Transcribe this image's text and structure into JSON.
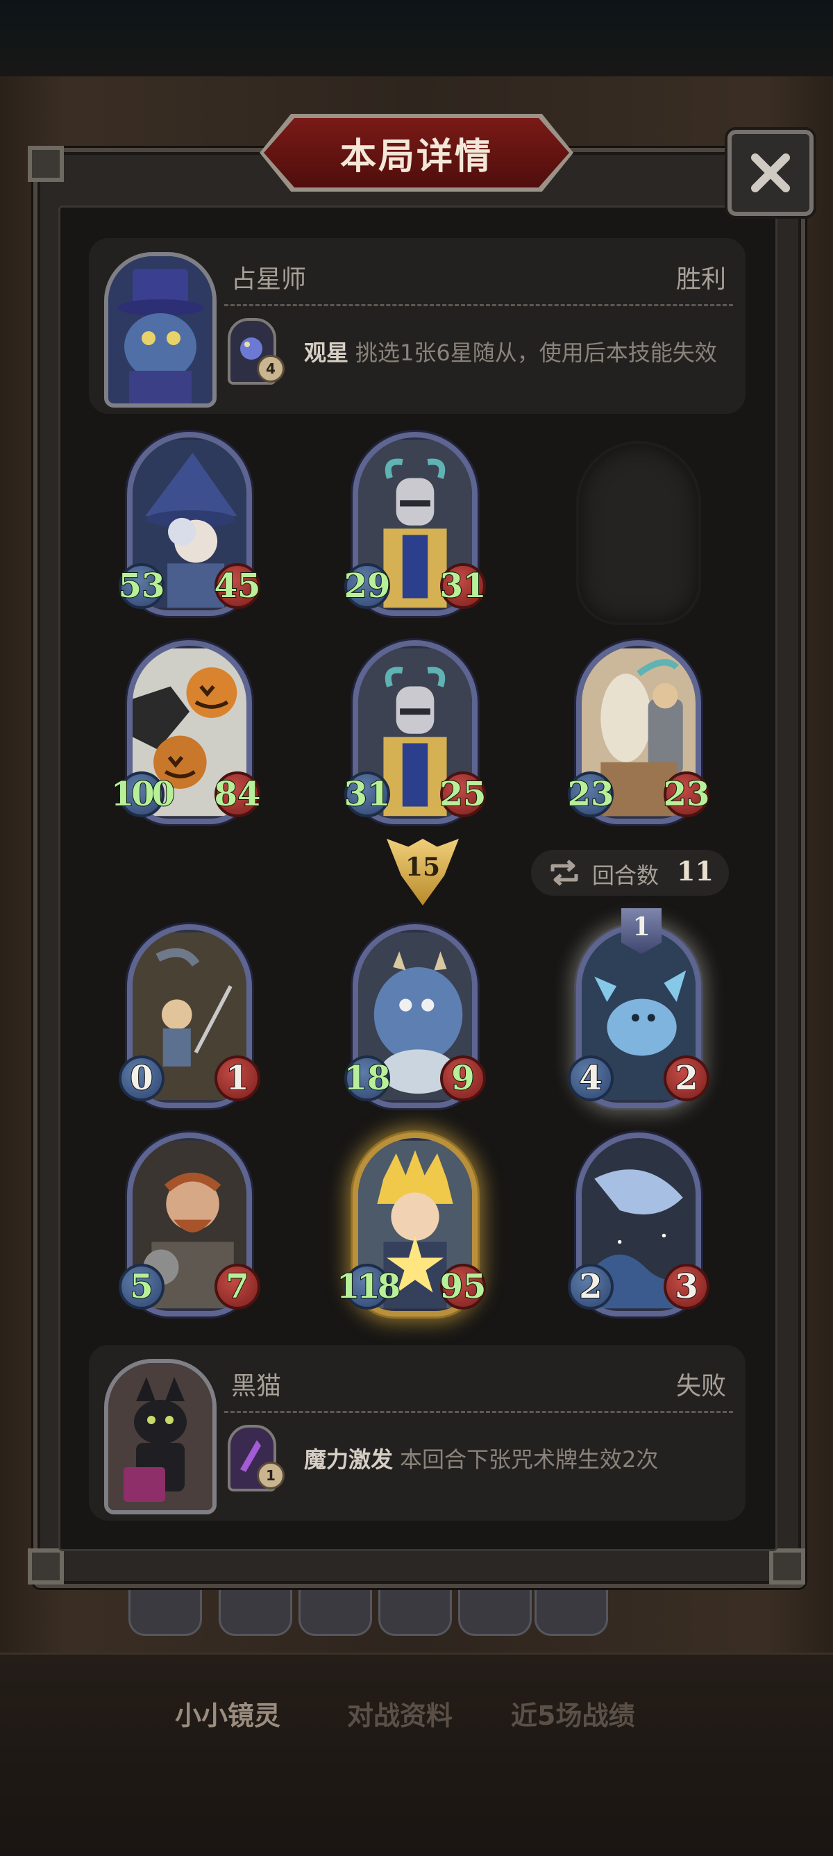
{
  "window": {
    "title": "本局详情"
  },
  "player_top": {
    "name": "占星师",
    "result": "胜利",
    "skill": {
      "level": "4",
      "name": "观星",
      "desc": "挑选1张6星随从，使用后本技能失效"
    }
  },
  "player_bottom": {
    "name": "黑猫",
    "result": "失败",
    "skill": {
      "level": "1",
      "name": "魔力激发",
      "desc": "本回合下张咒术牌生效2次"
    }
  },
  "top_board": [
    {
      "atk": "53",
      "hp": "45",
      "art": "witch"
    },
    {
      "atk": "29",
      "hp": "31",
      "art": "knight"
    },
    {
      "empty": true
    },
    {
      "atk": "100",
      "hp": "84",
      "art": "pumpkin"
    },
    {
      "atk": "31",
      "hp": "25",
      "art": "knight"
    },
    {
      "atk": "23",
      "hp": "23",
      "art": "rider"
    }
  ],
  "bottom_board": [
    {
      "atk": "0",
      "hp": "1",
      "art": "boy"
    },
    {
      "atk": "18",
      "hp": "9",
      "art": "dragon"
    },
    {
      "atk": "4",
      "hp": "2",
      "art": "crab",
      "level": "1"
    },
    {
      "atk": "5",
      "hp": "7",
      "art": "dwarf"
    },
    {
      "atk": "118",
      "hp": "95",
      "art": "star-boy",
      "golden": true
    },
    {
      "atk": "2",
      "hp": "3",
      "art": "whale"
    }
  ],
  "battle": {
    "attack_marker": "15",
    "round_label": "回合数",
    "round_value": "11"
  },
  "bottom_tabs": [
    "小小镜灵",
    "对战资料",
    "近5场战绩"
  ],
  "colors": {
    "title_plate": "#7a1a17",
    "atk_orb": "#3f5f8f",
    "hp_orb": "#a3332f",
    "stat_green": "#b8f09a",
    "gold_frame": "#b9903b"
  }
}
